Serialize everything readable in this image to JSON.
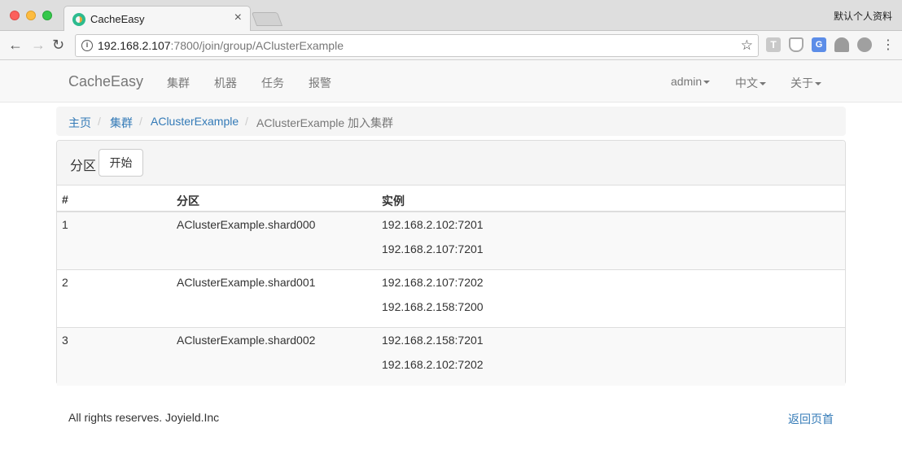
{
  "browser": {
    "tab_title": "CacheEasy",
    "profile_label": "默认个人资料",
    "url_host": "192.168.2.107",
    "url_rest": ":7800/join/group/AClusterExample"
  },
  "navbar": {
    "brand": "CacheEasy",
    "links": [
      "集群",
      "机器",
      "任务",
      "报警"
    ],
    "user_menu": "admin",
    "language_menu": "中文",
    "about_menu": "关于"
  },
  "breadcrumb": {
    "home": "主页",
    "clusters": "集群",
    "cluster": "AClusterExample",
    "current": "AClusterExample 加入集群",
    "separator": "/"
  },
  "panel": {
    "title": "分区",
    "start_button": "开始",
    "columns": [
      "#",
      "分区",
      "实例"
    ],
    "rows": [
      {
        "index": "1",
        "shard": "AClusterExample.shard000",
        "instances": [
          "192.168.2.102:7201",
          "192.168.2.107:7201"
        ]
      },
      {
        "index": "2",
        "shard": "AClusterExample.shard001",
        "instances": [
          "192.168.2.107:7202",
          "192.168.2.158:7200"
        ]
      },
      {
        "index": "3",
        "shard": "AClusterExample.shard002",
        "instances": [
          "192.168.2.158:7201",
          "192.168.2.102:7202"
        ]
      }
    ]
  },
  "footer": {
    "copyright": "All rights reserves. Joyield.Inc",
    "back_to_top": "返回页首"
  },
  "colors": {
    "link": "#337ab7",
    "navbar_bg": "#f8f8f8",
    "panel_heading_bg": "#f5f5f5",
    "striped_row_bg": "#f9f9f9"
  }
}
